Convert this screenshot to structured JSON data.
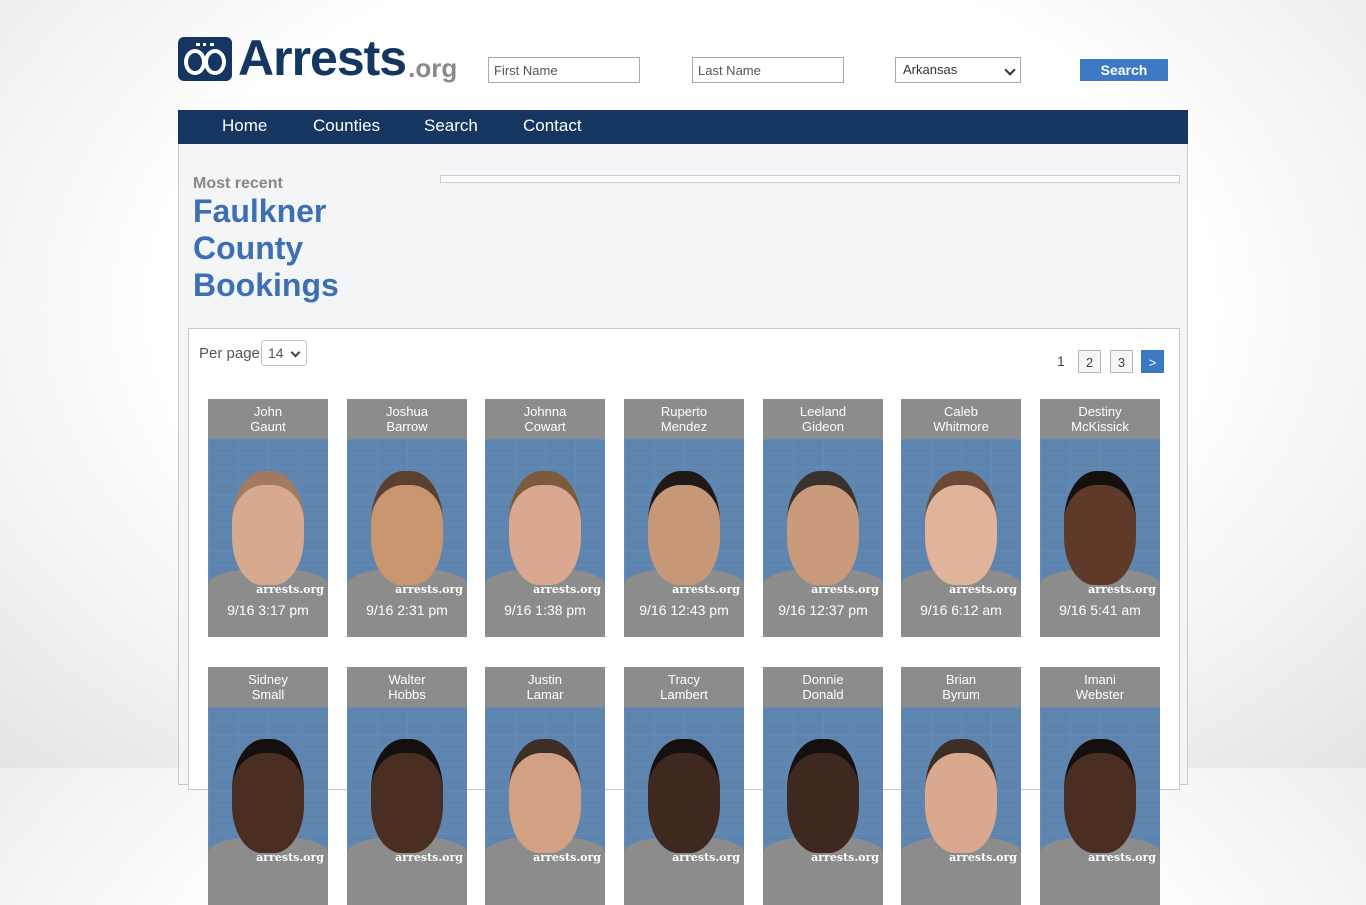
{
  "header": {
    "logo_text": "Arrests",
    "logo_ext": ".org",
    "first_name_placeholder": "First Name",
    "last_name_placeholder": "Last Name",
    "state_selected": "Arkansas",
    "search_label": "Search"
  },
  "nav": {
    "items": [
      {
        "label": "Home"
      },
      {
        "label": "Counties"
      },
      {
        "label": "Search"
      },
      {
        "label": "Contact"
      }
    ]
  },
  "main": {
    "most_recent": "Most recent",
    "county_title": "Faulkner County Bookings",
    "per_page_label": "Per page",
    "per_page_value": "14",
    "pager": {
      "current": "1",
      "pages": [
        "2",
        "3"
      ],
      "next": ">"
    }
  },
  "watermark": "arrests.org",
  "bookings": [
    {
      "first": "John",
      "last": "Gaunt",
      "time": "9/16 3:17 pm",
      "skin": "#d7a98f",
      "hair": "#a27a60"
    },
    {
      "first": "Joshua",
      "last": "Barrow",
      "time": "9/16 2:31 pm",
      "skin": "#c9966f",
      "hair": "#5b4030"
    },
    {
      "first": "Johnna",
      "last": "Cowart",
      "time": "9/16 1:38 pm",
      "skin": "#d9a88e",
      "hair": "#7c5b3c"
    },
    {
      "first": "Ruperto",
      "last": "Mendez",
      "time": "9/16 12:43 pm",
      "skin": "#c79878",
      "hair": "#1f1a17"
    },
    {
      "first": "Leeland",
      "last": "Gideon",
      "time": "9/16 12:37 pm",
      "skin": "#c99b7c",
      "hair": "#3a322c"
    },
    {
      "first": "Caleb",
      "last": "Whitmore",
      "time": "9/16 6:12 am",
      "skin": "#e0b39b",
      "hair": "#6c4a34"
    },
    {
      "first": "Destiny",
      "last": "McKissick",
      "time": "9/16 5:41 am",
      "skin": "#5f3a28",
      "hair": "#141010"
    },
    {
      "first": "Sidney",
      "last": "Small",
      "time": "",
      "skin": "#4a2e22",
      "hair": "#141010"
    },
    {
      "first": "Walter",
      "last": "Hobbs",
      "time": "",
      "skin": "#4a2e22",
      "hair": "#141010"
    },
    {
      "first": "Justin",
      "last": "Lamar",
      "time": "",
      "skin": "#d2a184",
      "hair": "#3d2f28"
    },
    {
      "first": "Tracy",
      "last": "Lambert",
      "time": "",
      "skin": "#3f2820",
      "hair": "#141010"
    },
    {
      "first": "Donnie",
      "last": "Donald",
      "time": "",
      "skin": "#3f2820",
      "hair": "#141010"
    },
    {
      "first": "Brian",
      "last": "Byrum",
      "time": "",
      "skin": "#d8a98e",
      "hair": "#3d2f28"
    },
    {
      "first": "Imani",
      "last": "Webster",
      "time": "",
      "skin": "#4a2e22",
      "hair": "#141010"
    }
  ]
}
